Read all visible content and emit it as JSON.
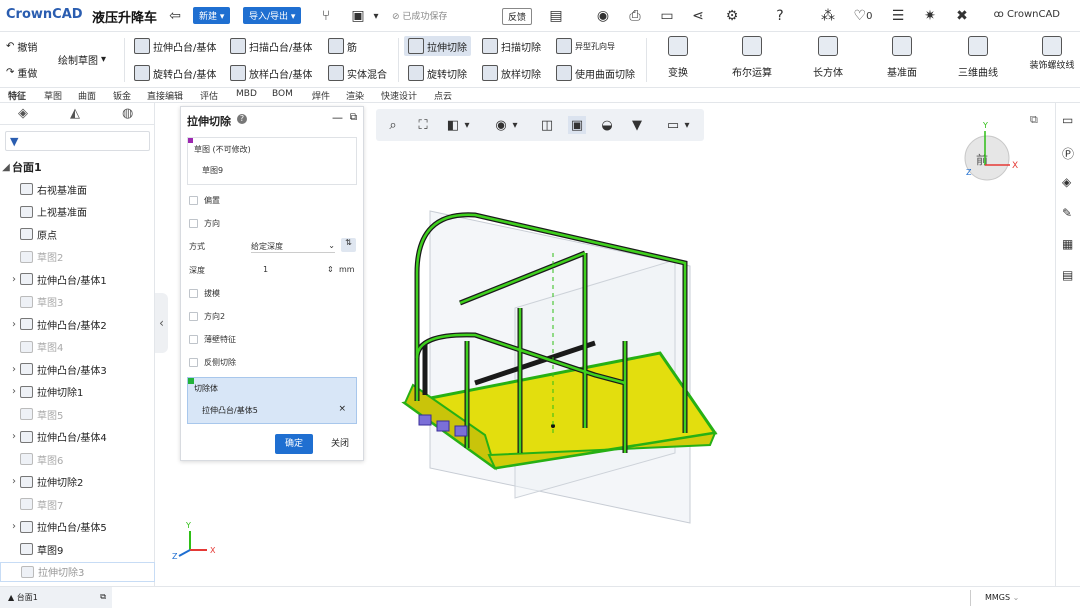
{
  "app": {
    "logo": "CrownCAD",
    "document_name": "液压升降车",
    "new_button": "新建",
    "import_export_button": "导入/导出",
    "save_status": "已成功保存",
    "feedback": "反馈",
    "like_count": "0",
    "brand": "CrownCAD"
  },
  "ribbon": {
    "undo": "撤销",
    "redo": "重做",
    "sketch": "绘制草图",
    "extrude_boss": "拉伸凸台/基体",
    "sweep_boss": "扫描凸台/基体",
    "rib": "筋",
    "extrude_cut": "拉伸切除",
    "sweep_cut": "扫描切除",
    "hole_wizard": "异型孔向导",
    "revolve_boss": "旋转凸台/基体",
    "loft_boss": "放样凸台/基体",
    "solid_mix": "实体混合",
    "revolve_cut": "旋转切除",
    "loft_cut": "放样切除",
    "surface_cut": "使用曲面切除",
    "transform": "变换",
    "boolean": "布尔运算",
    "box": "长方体",
    "plane": "基准面",
    "curve3d": "三维曲线",
    "thread": "装饰螺纹线"
  },
  "tabs": [
    "特征",
    "草图",
    "曲面",
    "钣金",
    "直接编辑",
    "评估",
    "MBD",
    "BOM",
    "焊件",
    "渲染",
    "快速设计",
    "点云"
  ],
  "tree": {
    "root": "台面1",
    "items": [
      {
        "label": "右视基准面",
        "dim": false,
        "arrow": false
      },
      {
        "label": "上视基准面",
        "dim": false,
        "arrow": false
      },
      {
        "label": "原点",
        "dim": false,
        "arrow": false
      },
      {
        "label": "草图2",
        "dim": true,
        "arrow": false
      },
      {
        "label": "拉伸凸台/基体1",
        "dim": false,
        "arrow": true
      },
      {
        "label": "草图3",
        "dim": true,
        "arrow": false
      },
      {
        "label": "拉伸凸台/基体2",
        "dim": false,
        "arrow": true
      },
      {
        "label": "草图4",
        "dim": true,
        "arrow": false
      },
      {
        "label": "拉伸凸台/基体3",
        "dim": false,
        "arrow": true
      },
      {
        "label": "拉伸切除1",
        "dim": false,
        "arrow": true
      },
      {
        "label": "草图5",
        "dim": true,
        "arrow": false
      },
      {
        "label": "拉伸凸台/基体4",
        "dim": false,
        "arrow": true
      },
      {
        "label": "草图6",
        "dim": true,
        "arrow": false
      },
      {
        "label": "拉伸切除2",
        "dim": false,
        "arrow": true
      },
      {
        "label": "草图7",
        "dim": true,
        "arrow": false
      },
      {
        "label": "拉伸凸台/基体5",
        "dim": false,
        "arrow": true
      },
      {
        "label": "草图9",
        "dim": false,
        "arrow": false
      },
      {
        "label": "拉伸切除3",
        "dim": true,
        "arrow": false
      }
    ]
  },
  "panel": {
    "title": "拉伸切除",
    "sketch_header": "草图 (不可修改)",
    "sketch_value": "草图9",
    "offset": "偏置",
    "direction": "方向",
    "method_label": "方式",
    "method_value": "给定深度",
    "depth_label": "深度",
    "depth_value": "1",
    "depth_unit": "mm",
    "draft": "拔模",
    "direction2": "方向2",
    "thin": "薄壁特征",
    "flip_cut": "反侧切除",
    "cut_body_label": "切除体",
    "cut_body_value": "拉伸凸台/基体5",
    "ok": "确定",
    "close": "关闭"
  },
  "viewcube": {
    "front": "前",
    "x": "X",
    "y": "Y",
    "z": "Z"
  },
  "triad": {
    "x": "X",
    "y": "Y",
    "z": "Z"
  },
  "bottom": {
    "tab": "台面1",
    "units": "MMGS"
  },
  "colors": {
    "accent": "#1f6fd1",
    "model_yellow": "#e9e50c",
    "model_green": "#2fbf16"
  }
}
